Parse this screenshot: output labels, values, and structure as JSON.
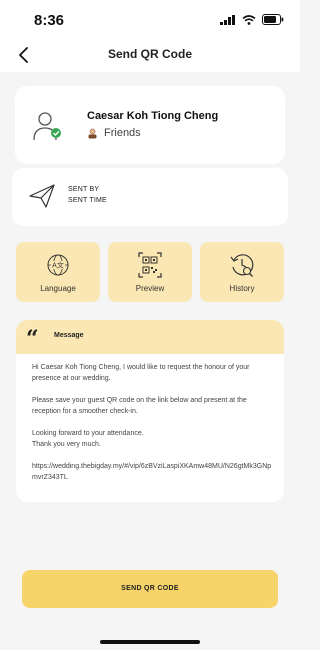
{
  "status_bar": {
    "time": "8:36"
  },
  "header": {
    "title": "Send QR Code"
  },
  "contact": {
    "name": "Caesar Koh Tiong Cheng",
    "relation": "Friends"
  },
  "sent_info": {
    "sent_by_label": "SENT BY",
    "sent_time_label": "SENT TIME"
  },
  "actions": [
    {
      "label": "Language",
      "icon": "language-icon"
    },
    {
      "label": "Preview",
      "icon": "qr-preview-icon"
    },
    {
      "label": "History",
      "icon": "history-icon"
    }
  ],
  "message": {
    "title": "Message",
    "paragraphs": [
      "Hi Caesar Koh Tiong Cheng, I would like to request the honour of your presence at our wedding.",
      "Please save your guest QR code on the link below and present at the reception for a smoother check-in.",
      "Looking forward to your attendance.",
      "Thank you very much.",
      "https://wedding.thebigday.my/#/vip/6zBVziLaspiXKAmw48MU/N26gtMk3GNpmvrZ343TL"
    ]
  },
  "send_button": {
    "label": "SEND QR CODE"
  },
  "colors": {
    "accent": "#f7d46a",
    "accent_light": "#fbe7b3",
    "background": "#f5f5f5",
    "card": "#ffffff"
  }
}
